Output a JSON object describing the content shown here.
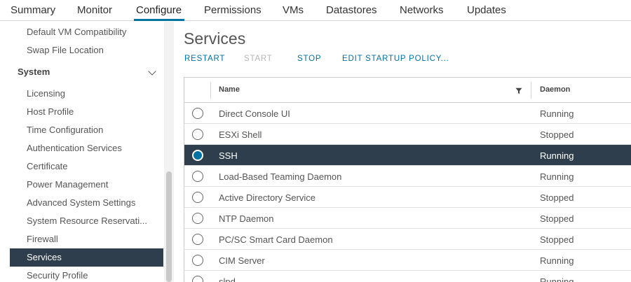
{
  "tabs": [
    {
      "label": "Summary",
      "active": false
    },
    {
      "label": "Monitor",
      "active": false
    },
    {
      "label": "Configure",
      "active": true
    },
    {
      "label": "Permissions",
      "active": false
    },
    {
      "label": "VMs",
      "active": false
    },
    {
      "label": "Datastores",
      "active": false
    },
    {
      "label": "Networks",
      "active": false
    },
    {
      "label": "Updates",
      "active": false
    }
  ],
  "sidebar": {
    "items_before": [
      "Default VM Compatibility",
      "Swap File Location"
    ],
    "group": {
      "label": "System",
      "expanded": true,
      "icon": "chevron-down-icon"
    },
    "items": [
      "Licensing",
      "Host Profile",
      "Time Configuration",
      "Authentication Services",
      "Certificate",
      "Power Management",
      "Advanced System Settings",
      "System Resource Reservati...",
      "Firewall",
      "Services",
      "Security Profile"
    ],
    "selected": "Services"
  },
  "main": {
    "title": "Services",
    "actions": [
      {
        "label": "RESTART",
        "enabled": true
      },
      {
        "label": "START",
        "enabled": false
      },
      {
        "label": "STOP",
        "enabled": true
      },
      {
        "label": "EDIT STARTUP POLICY...",
        "enabled": true
      }
    ],
    "grid": {
      "columns": [
        {
          "label": "Name",
          "filter_icon": "filter-icon"
        },
        {
          "label": "Daemon"
        }
      ],
      "rows": [
        {
          "name": "Direct Console UI",
          "daemon": "Running",
          "selected": false
        },
        {
          "name": "ESXi Shell",
          "daemon": "Stopped",
          "selected": false
        },
        {
          "name": "SSH",
          "daemon": "Running",
          "selected": true
        },
        {
          "name": "Load-Based Teaming Daemon",
          "daemon": "Running",
          "selected": false
        },
        {
          "name": "Active Directory Service",
          "daemon": "Stopped",
          "selected": false
        },
        {
          "name": "NTP Daemon",
          "daemon": "Stopped",
          "selected": false
        },
        {
          "name": "PC/SC Smart Card Daemon",
          "daemon": "Stopped",
          "selected": false
        },
        {
          "name": "CIM Server",
          "daemon": "Running",
          "selected": false
        },
        {
          "name": "slpd",
          "daemon": "Running",
          "selected": false
        }
      ]
    }
  },
  "colors": {
    "accent": "#0072a3",
    "selected_row_bg": "#2f3e4d",
    "disabled_action": "#b5b5b5"
  }
}
